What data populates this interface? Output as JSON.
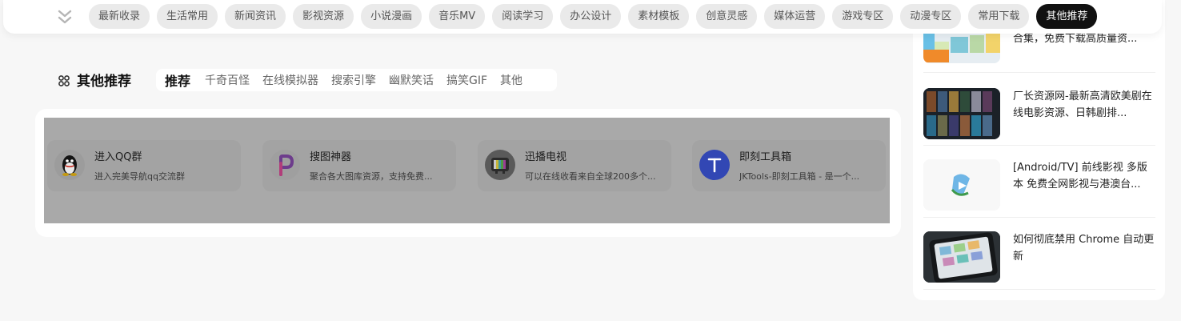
{
  "nav": {
    "categories": [
      "最新收录",
      "生活常用",
      "新闻资讯",
      "影视资源",
      "小说漫画",
      "音乐MV",
      "阅读学习",
      "办公设计",
      "素材模板",
      "创意灵感",
      "媒体运营",
      "游戏专区",
      "动漫专区",
      "常用下载",
      "其他推荐"
    ],
    "active": "其他推荐"
  },
  "section": {
    "title": "其他推荐",
    "tabs": [
      "推荐",
      "千奇百怪",
      "在线模拟器",
      "搜索引擎",
      "幽默笑话",
      "搞笑GIF",
      "其他"
    ]
  },
  "sites": [
    {
      "name": "进入QQ群",
      "desc": "进入完美导航qq交流群",
      "icon": "qq-penguin-icon"
    },
    {
      "name": "搜图神器",
      "desc": "聚合各大图库资源，支持免费...",
      "icon": "sotu-p-icon"
    },
    {
      "name": "迅播电视",
      "desc": "可以在线收看来自全球200多个...",
      "icon": "tv-icon"
    },
    {
      "name": "即刻工具箱",
      "desc": "JKTools-即刻工具箱 - 是一个...",
      "icon": "jktools-t-icon"
    }
  ],
  "sidebar": {
    "posts": [
      {
        "title": "合集，免费下载高质量资..."
      },
      {
        "title": "厂长资源网-最新高清欧美剧在线电影资源、日韩剧排..."
      },
      {
        "title": "[Android/TV] 前线影视 多版本 免费全网影视与港澳台..."
      },
      {
        "title": "如何彻底禁用 Chrome 自动更新"
      }
    ]
  },
  "colors": {
    "active_bg": "#111111",
    "pill_bg": "#eaeaea",
    "overlay_gray": "#a9a9a9",
    "page_bg": "#f7f7f7"
  }
}
